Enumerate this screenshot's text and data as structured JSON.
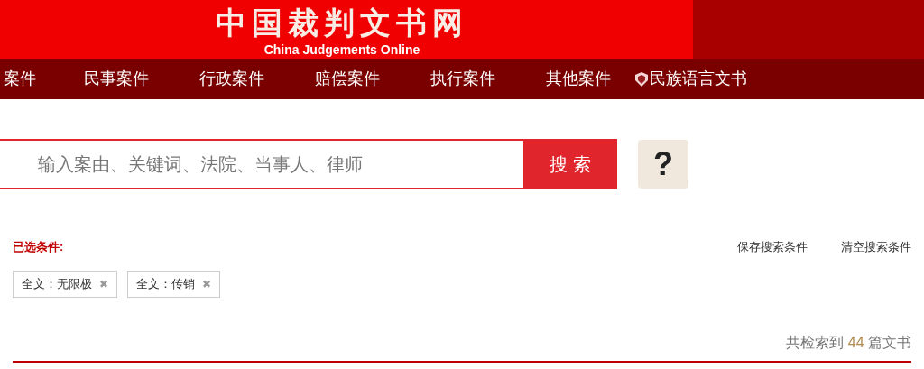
{
  "header": {
    "title": "中国裁判文书网",
    "subtitle": "China Judgements Online"
  },
  "nav": [
    {
      "label": "案件",
      "kind": "text"
    },
    {
      "label": "民事案件",
      "kind": "text"
    },
    {
      "label": "行政案件",
      "kind": "text"
    },
    {
      "label": "赔偿案件",
      "kind": "text"
    },
    {
      "label": "执行案件",
      "kind": "text"
    },
    {
      "label": "其他案件",
      "kind": "text"
    },
    {
      "label": "民族语言文书",
      "kind": "icon"
    }
  ],
  "search": {
    "placeholder": "输入案由、关键词、法院、当事人、律师",
    "button": "搜 索",
    "help": "?"
  },
  "conditions": {
    "label": "已选条件:",
    "actions": [
      "保存搜索条件",
      "清空搜索条件"
    ],
    "tags": [
      {
        "label": "全文：无限极",
        "remove": "✖"
      },
      {
        "label": "全文：传销",
        "remove": "✖"
      }
    ]
  },
  "result": {
    "prefix": "共检索到",
    "count": "44",
    "suffix": "篇文书"
  }
}
